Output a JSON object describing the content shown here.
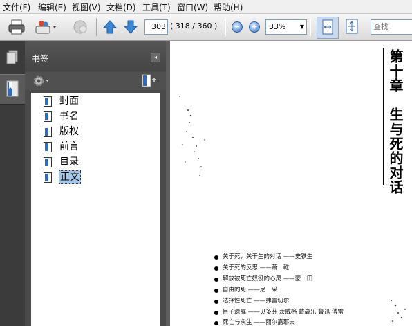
{
  "menu": [
    "文件(F)",
    "编辑(E)",
    "视图(V)",
    "文档(D)",
    "工具(T)",
    "窗口(W)",
    "帮助(H)"
  ],
  "toolbar": {
    "page_current": "303",
    "page_info": "( 318 / 360 )",
    "zoom": "33%",
    "search_placeholder": "查找",
    "zoom_out_symbol": "−",
    "zoom_in_symbol": "+"
  },
  "panel": {
    "title": "书签",
    "collapse_symbol": "◂"
  },
  "bookmarks": [
    "封面",
    "书名",
    "版权",
    "前言",
    "目录",
    "正文"
  ],
  "selected_bookmark_index": 5,
  "document": {
    "chapter_title": "第十章　生与死的对话",
    "toc": [
      "关于死，关于生的对话 ——史铁生",
      "关于死的反思 ——萧　乾",
      "解放被死亡奴役的心灵 ——蒙　田",
      "自由的死 ——尼　采",
      "选择性死亡 ——弗雷切尔",
      "巨子遗嘱 ——贝多芬 茨威格 戴高乐 鲁迅 傅雷",
      "死亡与永生 ——丽尔嘉耶夫"
    ]
  }
}
